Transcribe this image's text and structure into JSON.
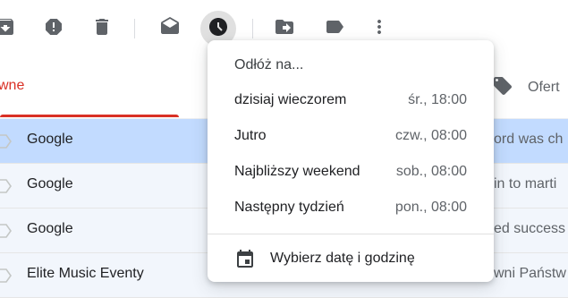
{
  "toolbar": {
    "icons": [
      "archive-icon",
      "report-spam-icon",
      "delete-icon",
      "mark-as-read-icon",
      "snooze-icon",
      "move-to-icon",
      "label-icon",
      "more-icon"
    ]
  },
  "tabs": {
    "primary_label": "wne",
    "offers_label": "Ofert"
  },
  "messages": [
    {
      "sender": "Google",
      "snippet": "ord was ch",
      "selected": true
    },
    {
      "sender": "Google",
      "snippet": "in to marti",
      "selected": false
    },
    {
      "sender": "Google",
      "snippet": "ed success",
      "selected": false
    },
    {
      "sender": "Elite Music Eventy",
      "snippet": "wni Państw",
      "selected": false
    }
  ],
  "snooze_menu": {
    "title": "Odłóż na...",
    "items": [
      {
        "label": "dzisiaj wieczorem",
        "time": "śr., 18:00"
      },
      {
        "label": "Jutro",
        "time": "czw., 08:00"
      },
      {
        "label": "Najbliższy weekend",
        "time": "sob., 08:00"
      },
      {
        "label": "Następny tydzień",
        "time": "pon., 08:00"
      }
    ],
    "pick_label": "Wybierz datę i godzinę"
  },
  "colors": {
    "accent_red": "#d93025",
    "selected_row": "#c2dbff",
    "read_row": "#f2f6fc"
  }
}
